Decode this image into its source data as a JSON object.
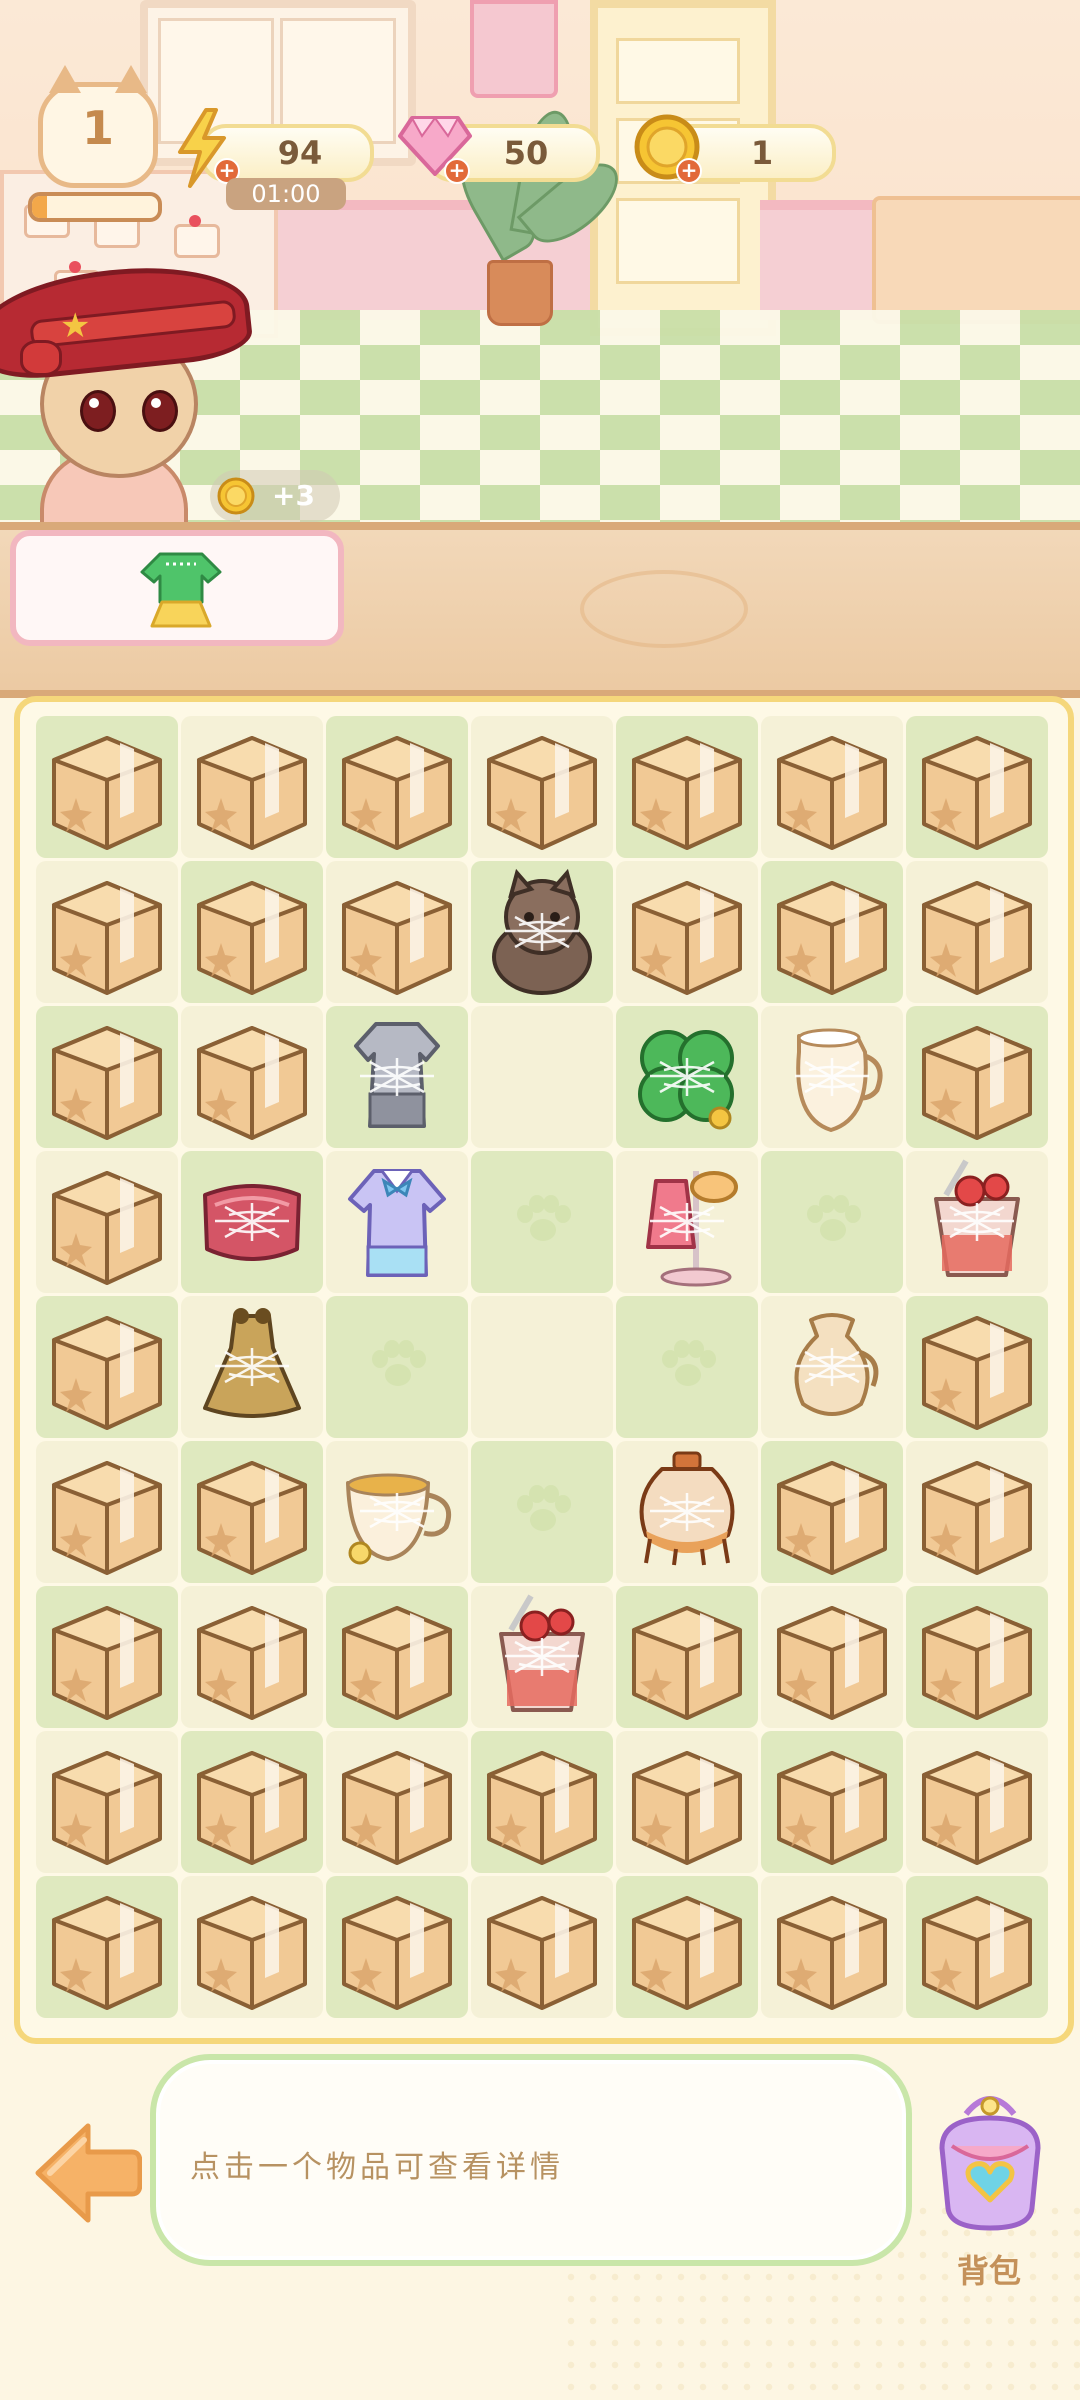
{
  "hud": {
    "level": "1",
    "level_progress": 0.12,
    "energy": "94",
    "energy_timer": "01:00",
    "gems": "50",
    "coins": "1",
    "coin_reward": "+3",
    "plus": "+"
  },
  "order": {
    "item_icon": "green-sweater-yellow-skirt-icon"
  },
  "board": {
    "columns": 7,
    "rows": 9,
    "cells": [
      "box",
      "box",
      "box",
      "box",
      "box",
      "box",
      "box",
      "box",
      "box",
      "box",
      "brown-cat-plush",
      "box",
      "box",
      "box",
      "box",
      "box",
      "gray-dress",
      "empty",
      "green-clover-bush",
      "milk-pitcher",
      "box",
      "box",
      "red-velvet-cushion",
      "lavender-blouse",
      "paw",
      "pink-coat-rack",
      "paw",
      "fruit-sundae-cup",
      "box",
      "gold-dress",
      "paw",
      "empty",
      "paw",
      "cream-vase",
      "box",
      "box",
      "box",
      "tea-cup",
      "paw",
      "honey-jar",
      "box",
      "box",
      "box",
      "box",
      "box",
      "fruit-sundae-cup",
      "box",
      "box",
      "box",
      "box",
      "box",
      "box",
      "box",
      "box",
      "box",
      "box",
      "box",
      "box",
      "box",
      "box",
      "box",
      "box",
      "box"
    ],
    "webbed": [
      "brown-cat-plush",
      "gray-dress",
      "green-clover-bush",
      "milk-pitcher",
      "red-velvet-cushion",
      "lavender-blouse",
      "pink-coat-rack",
      "fruit-sundae-cup",
      "gold-dress",
      "cream-vase",
      "tea-cup",
      "honey-jar"
    ]
  },
  "bottom": {
    "info_text": "点击一个物品可查看详情",
    "bag_label": "背包",
    "back_icon": "back-arrow-icon",
    "bag_icon": "heart-purse-icon"
  },
  "colors": {
    "accent_orange": "#f6b267",
    "board_border": "#f5d77b",
    "cell_dark": "#dfe9bf",
    "cell_light": "#f5f1d7",
    "info_border": "#c9e6a9"
  }
}
